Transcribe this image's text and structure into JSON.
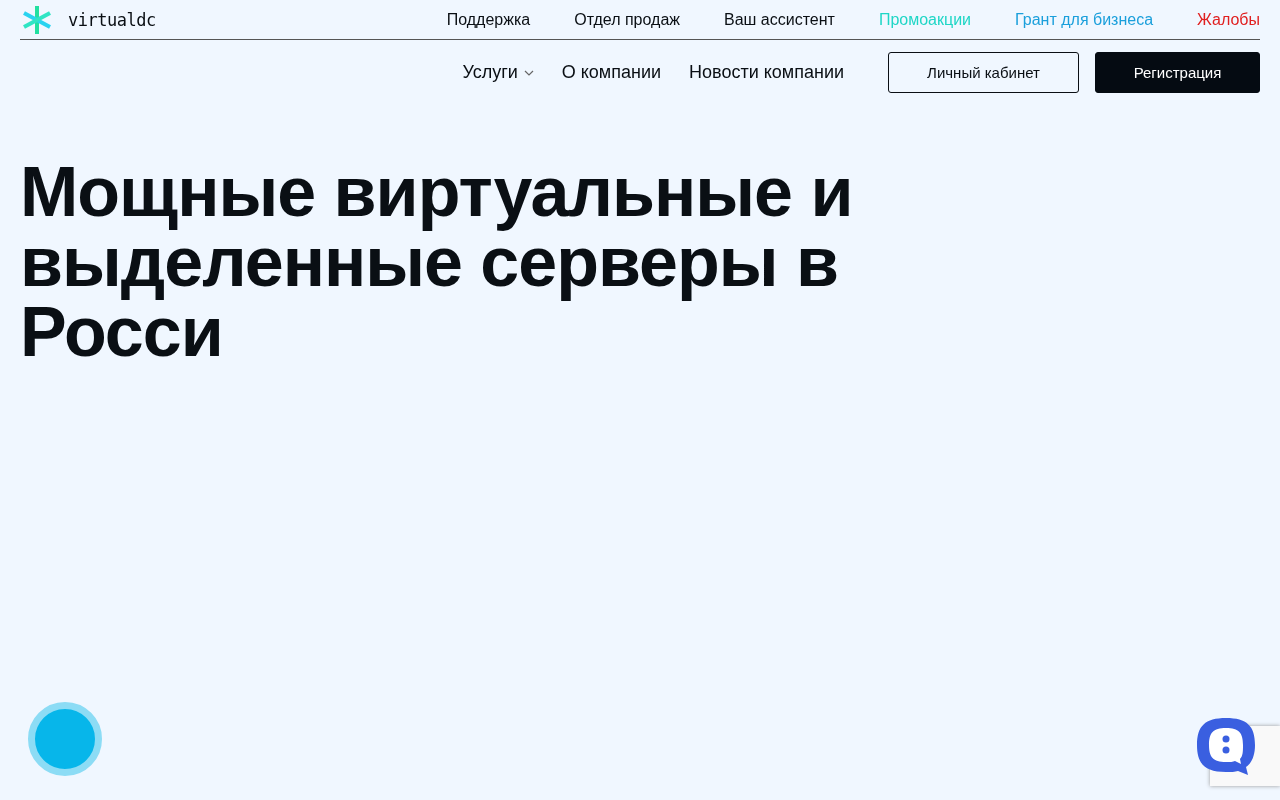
{
  "logo": {
    "text": "virtualdc"
  },
  "top_links": [
    {
      "label": "Поддержка",
      "color": "#0a0f14"
    },
    {
      "label": "Отдел продаж",
      "color": "#0a0f14"
    },
    {
      "label": "Ваш ассистент",
      "color": "#0a0f14"
    },
    {
      "label": "Промоакции",
      "color": "#1fd6c6"
    },
    {
      "label": "Грант для бизнеса",
      "color": "#1a9fdb"
    },
    {
      "label": "Жалобы",
      "color": "#e02020"
    }
  ],
  "main_nav": [
    {
      "label": "Услуги",
      "dropdown": true
    },
    {
      "label": "О компании",
      "dropdown": false
    },
    {
      "label": "Новости компании",
      "dropdown": false
    }
  ],
  "buttons": [
    {
      "label": "Личный кабинет",
      "kind": "outline"
    },
    {
      "label": "Регистрация",
      "kind": "solid"
    }
  ],
  "hero": {
    "title": "Мощные виртуальные и выделенные серверы в Росси"
  }
}
